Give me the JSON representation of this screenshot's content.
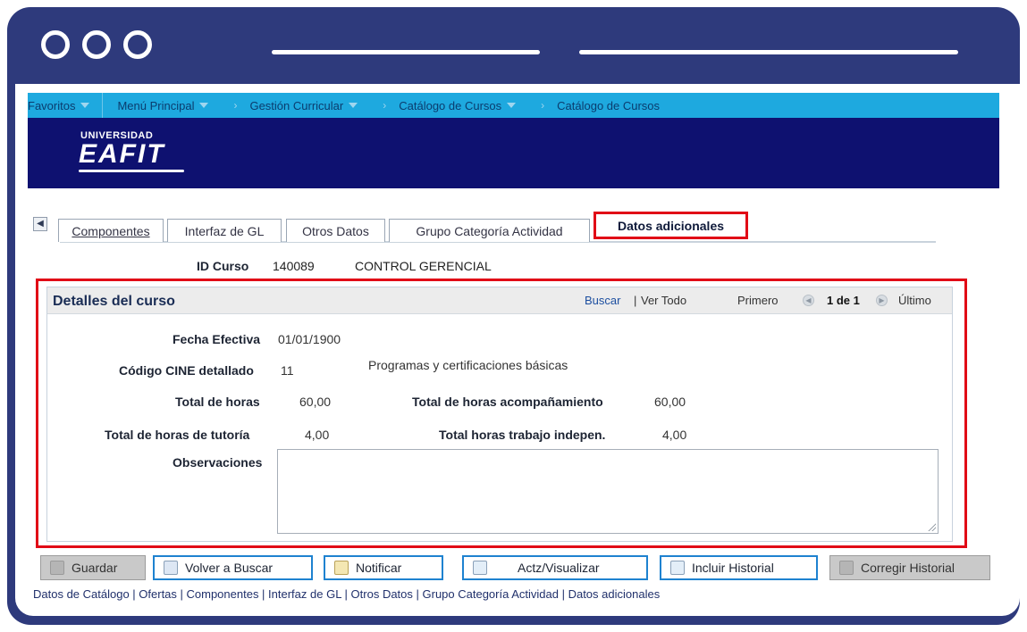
{
  "nav": {
    "favoritos": "Favoritos",
    "menu_principal": "Menú Principal",
    "gestion_curricular": "Gestión Curricular",
    "catalogo_cursos_1": "Catálogo de Cursos",
    "catalogo_cursos_2": "Catálogo de Cursos"
  },
  "banner": {
    "logo_small": "UNIVERSIDAD",
    "logo_big": "EAFIT"
  },
  "tabs": {
    "componentes": "Componentes",
    "interfaz_gl": "Interfaz de GL",
    "otros_datos": "Otros Datos",
    "grupo_categoria": "Grupo Categoría Actividad",
    "datos_adicionales": "Datos adicionales"
  },
  "course": {
    "id_label": "ID Curso",
    "id_value": "140089",
    "name": "CONTROL GERENCIAL"
  },
  "details": {
    "title": "Detalles del curso",
    "buscar": "Buscar",
    "divider": "|",
    "ver_todo": "Ver Todo",
    "primero": "Primero",
    "pager": "1 de 1",
    "ultimo": "Último",
    "fecha_efectiva_label": "Fecha Efectiva",
    "fecha_efectiva_value": "01/01/1900",
    "codigo_cine_label": "Código CINE detallado",
    "codigo_cine_value": "11",
    "codigo_cine_desc": "Programas y certificaciones básicas",
    "total_horas_label": "Total de horas",
    "total_horas_value": "60,00",
    "total_acomp_label": "Total de horas acompañamiento",
    "total_acomp_value": "60,00",
    "total_tutoria_label": "Total de horas de tutoría",
    "total_tutoria_value": "4,00",
    "total_indep_label": "Total horas trabajo indepen.",
    "total_indep_value": "4,00",
    "observaciones_label": "Observaciones",
    "observaciones_value": ""
  },
  "buttons": {
    "guardar": "Guardar",
    "volver_buscar": "Volver a Buscar",
    "notificar": "Notificar",
    "actz_visualizar": "Actz/Visualizar",
    "incluir_historial": "Incluir Historial",
    "corregir_historial": "Corregir Historial"
  },
  "footer_links": "Datos de Catálogo | Ofertas | Componentes | Interfaz de GL | Otros Datos | Grupo Categoría Actividad | Datos adicionales",
  "colors": {
    "frame": "#2e3a7c",
    "nav": "#1ea9df",
    "banner": "#0e1170",
    "highlight": "#e10a16"
  }
}
